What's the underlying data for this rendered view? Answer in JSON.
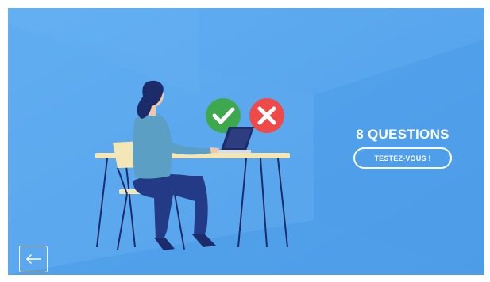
{
  "quiz": {
    "title": "8 QUESTIONS",
    "start_label": "TESTEZ-VOUS !"
  },
  "navigation": {
    "back_icon": "arrow-left-icon"
  },
  "icons": {
    "correct": "check-icon",
    "wrong": "close-icon"
  },
  "colors": {
    "background": "#5aa8f0",
    "correct": "#3ea84f",
    "wrong": "#ef4a4a",
    "text": "#ffffff"
  }
}
